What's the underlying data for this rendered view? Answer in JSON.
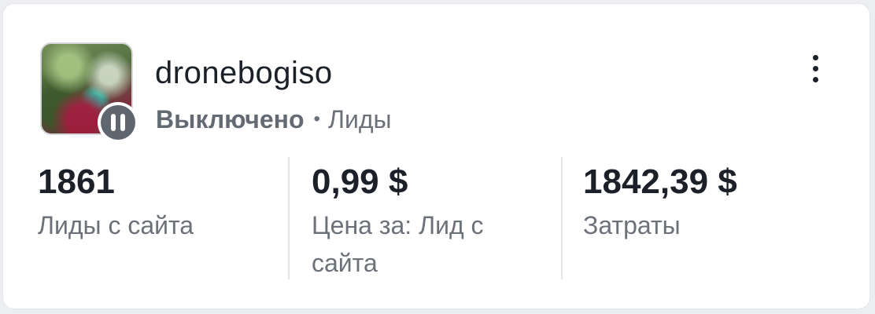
{
  "campaign": {
    "name": "dronebogiso",
    "status": "Выключено",
    "separator": "•",
    "objective": "Лиды"
  },
  "icons": {
    "status": "pause-icon",
    "menu": "more-vertical-icon"
  },
  "metrics": [
    {
      "value": "1861",
      "label": "Лиды с сайта"
    },
    {
      "value": "0,99 $",
      "label": "Цена за: Лид с сайта"
    },
    {
      "value": "1842,39 $",
      "label": "Затраты"
    }
  ]
}
